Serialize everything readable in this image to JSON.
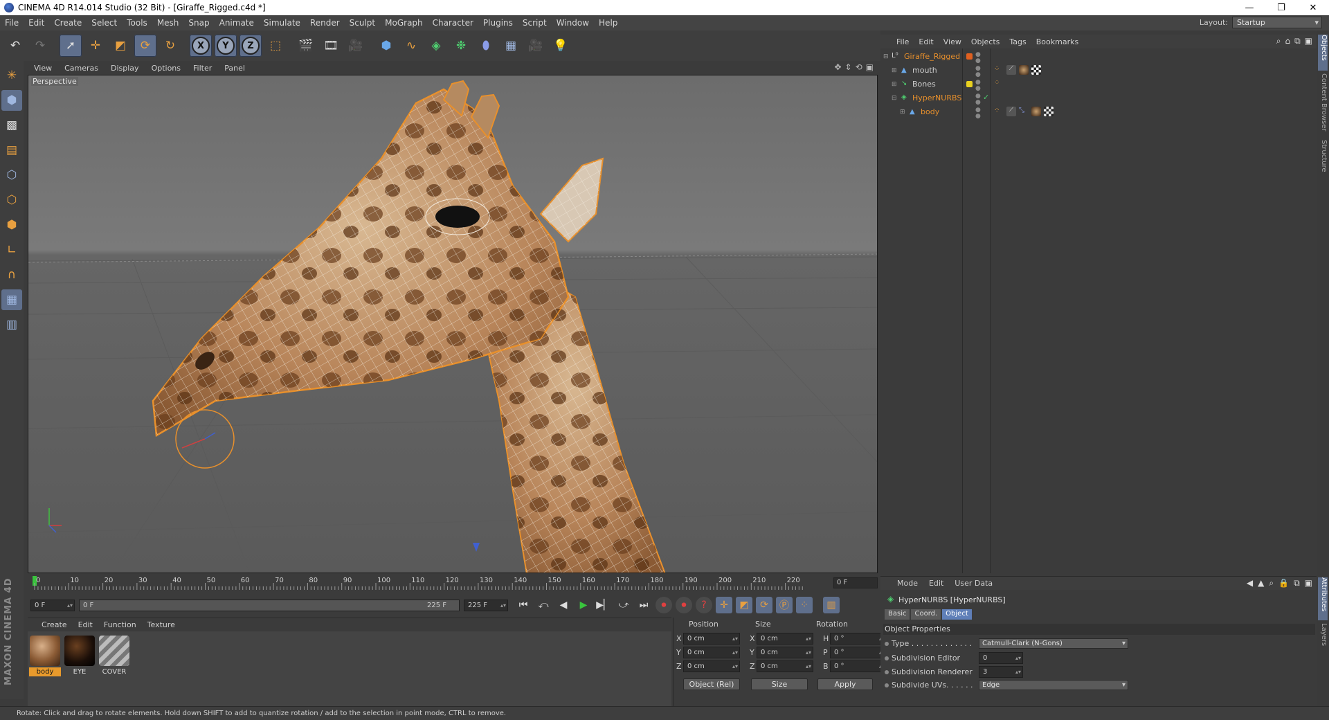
{
  "window": {
    "title": "CINEMA 4D R14.014 Studio (32 Bit) - [Giraffe_Rigged.c4d *]",
    "min": "—",
    "restore": "❐",
    "close": "✕"
  },
  "menubar": [
    "File",
    "Edit",
    "Create",
    "Select",
    "Tools",
    "Mesh",
    "Snap",
    "Animate",
    "Simulate",
    "Render",
    "Sculpt",
    "MoGraph",
    "Character",
    "Plugins",
    "Script",
    "Window",
    "Help"
  ],
  "layout": {
    "label": "Layout:",
    "value": "Startup"
  },
  "viewport": {
    "menu": [
      "View",
      "Cameras",
      "Display",
      "Options",
      "Filter",
      "Panel"
    ],
    "label": "Perspective"
  },
  "timeline": {
    "ticks": [
      "0",
      "10",
      "20",
      "30",
      "40",
      "50",
      "60",
      "70",
      "80",
      "90",
      "100",
      "110",
      "120",
      "130",
      "140",
      "150",
      "160",
      "170",
      "180",
      "190",
      "200",
      "210",
      "220"
    ],
    "current_frame": "0 F"
  },
  "playback": {
    "start": "0 F",
    "range_start": "0 F",
    "range_end": "225 F",
    "end": "225 F"
  },
  "materials": {
    "menu": [
      "Create",
      "Edit",
      "Function",
      "Texture"
    ],
    "items": [
      {
        "name": "body",
        "selected": true
      },
      {
        "name": "EYE",
        "selected": false
      },
      {
        "name": "COVER",
        "selected": false
      }
    ]
  },
  "coordinates": {
    "headers": {
      "position": "Position",
      "size": "Size",
      "rotation": "Rotation"
    },
    "rows": [
      {
        "axis": "X",
        "pos": "0 cm",
        "saxis": "X",
        "size": "0 cm",
        "raxis": "H",
        "rot": "0 °"
      },
      {
        "axis": "Y",
        "pos": "0 cm",
        "saxis": "Y",
        "size": "0 cm",
        "raxis": "P",
        "rot": "0 °"
      },
      {
        "axis": "Z",
        "pos": "0 cm",
        "saxis": "Z",
        "size": "0 cm",
        "raxis": "B",
        "rot": "0 °"
      }
    ],
    "mode": "Object (Rel)",
    "size_mode": "Size",
    "apply": "Apply"
  },
  "objects": {
    "menu": [
      "File",
      "Edit",
      "View",
      "Objects",
      "Tags",
      "Bookmarks"
    ],
    "rows": [
      {
        "name": "Giraffe_Rigged",
        "color": "#e8902c",
        "flag": "#e06020"
      },
      {
        "name": "mouth",
        "color": "#d0d0d0",
        "flag": ""
      },
      {
        "name": "Bones",
        "color": "#d0d0d0",
        "flag": "#e8d020"
      },
      {
        "name": "HyperNURBS",
        "color": "#e8902c",
        "flag": ""
      },
      {
        "name": "body",
        "color": "#e8902c",
        "flag": ""
      }
    ]
  },
  "sidetabs": [
    "Objects",
    "Content Browser",
    "Structure",
    "Attributes",
    "Layers"
  ],
  "attributes": {
    "menu": [
      "Mode",
      "Edit",
      "User Data"
    ],
    "object_title": "HyperNURBS [HyperNURBS]",
    "tabs": [
      "Basic",
      "Coord.",
      "Object"
    ],
    "section": "Object Properties",
    "props": [
      {
        "label": "Type . . . . . . . . . . . . .",
        "value": "Catmull-Clark (N-Gons)"
      },
      {
        "label": "Subdivision Editor",
        "value": "0"
      },
      {
        "label": "Subdivision Renderer",
        "value": "3"
      },
      {
        "label": "Subdivide UVs. . . . . .",
        "value": "Edge"
      }
    ]
  },
  "status": "Rotate: Click and drag to rotate elements. Hold down SHIFT to add to quantize rotation / add to the selection in point mode, CTRL to remove.",
  "brand": "MAXON CINEMA 4D",
  "colors": {
    "accent": "#e89a2c",
    "selection": "#5f6f8c"
  }
}
